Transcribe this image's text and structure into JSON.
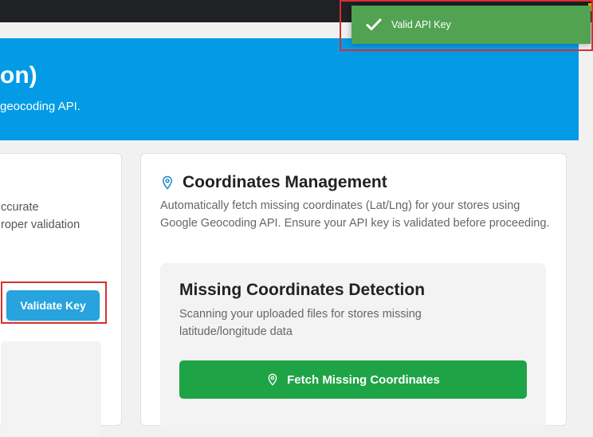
{
  "hero": {
    "title_fragment": "on)",
    "subtitle_fragment": "geocoding API."
  },
  "validation_card": {
    "description_fragment": "ccurate\nroper validation",
    "validate_button_label": "Validate Key"
  },
  "coordinates_card": {
    "title": "Coordinates Management",
    "description": "Automatically fetch missing coordinates (Lat/Lng) for your stores using Google Geocoding API. Ensure your API key is validated before proceeding.",
    "detection": {
      "title": "Missing Coordinates Detection",
      "description": "Scanning your uploaded files for stores missing latitude/longitude data",
      "fetch_button_label": "Fetch Missing Coordinates"
    }
  },
  "toast": {
    "message": "Valid API Key"
  },
  "colors": {
    "hero_bg": "#039be5",
    "validate_button": "#27a3dd",
    "fetch_button": "#1ea446",
    "toast_bg": "#51a351",
    "highlight": "#d63031"
  },
  "icons": {
    "map_pin": "map-pin-icon",
    "check": "check-icon"
  }
}
